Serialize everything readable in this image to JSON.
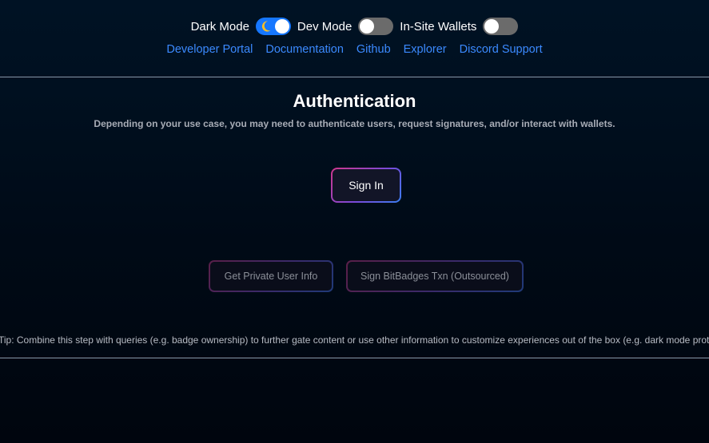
{
  "header": {
    "toggles": [
      {
        "label": "Dark Mode",
        "state": "on",
        "icon": "moon-icon"
      },
      {
        "label": "Dev Mode",
        "state": "off"
      },
      {
        "label": "In-Site Wallets",
        "state": "off"
      }
    ],
    "links": [
      "Developer Portal",
      "Documentation",
      "Github",
      "Explorer",
      "Discord Support"
    ]
  },
  "main": {
    "title": "Authentication",
    "subtitle": "Depending on your use case, you may need to authenticate users, request signatures, and/or interact with wallets.",
    "sign_in_label": "Sign In",
    "actions": [
      "Get Private User Info",
      "Sign BitBadges Txn (Outsourced)"
    ],
    "tip": "Tip: Combine this step with queries (e.g. badge ownership) to further gate content or use other information to customize experiences out of the box (e.g. dark mode prote"
  },
  "colors": {
    "background": "#001224",
    "link": "#3b8aff",
    "toggle_on": "#1677ff",
    "toggle_off": "#6b6b6b",
    "moon": "#fbbf24",
    "gradient_start": "#d0368a",
    "gradient_end": "#3a7ef0"
  }
}
